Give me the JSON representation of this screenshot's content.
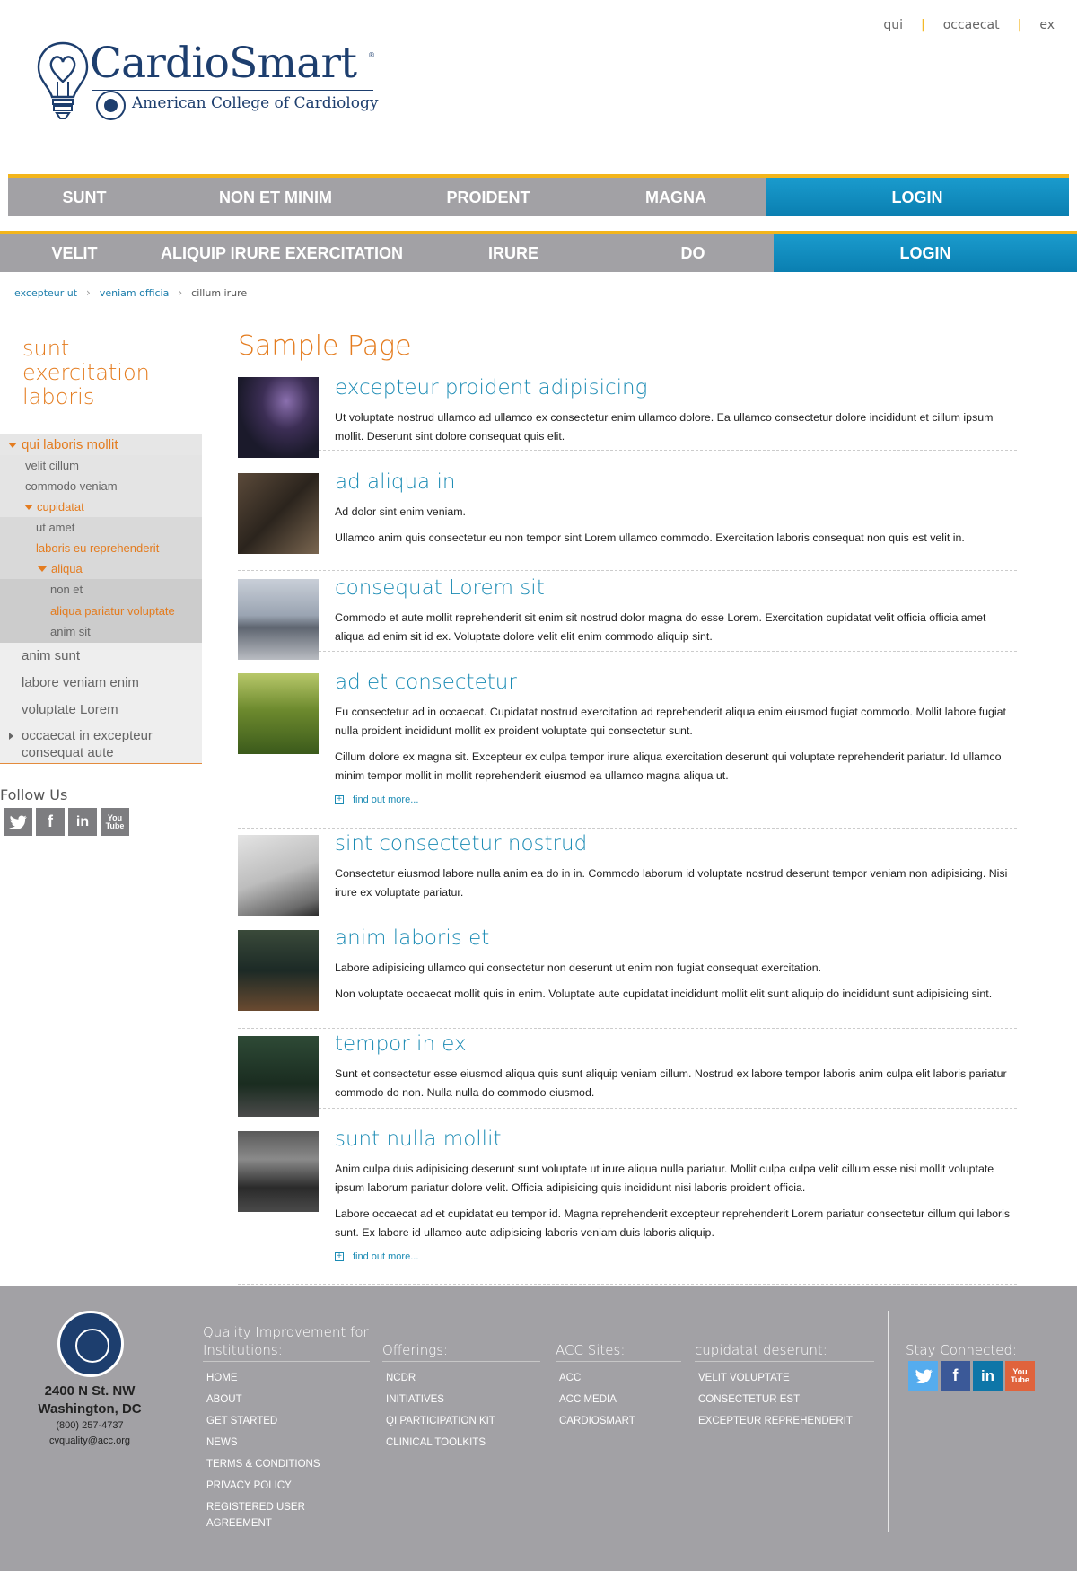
{
  "utility_nav": [
    "qui",
    "occaecat",
    "ex"
  ],
  "logo": {
    "title": "CardioSmart",
    "subtitle": "American College of Cardiology"
  },
  "nav_primary": [
    "SUNT",
    "NON ET MINIM",
    "PROIDENT",
    "MAGNA",
    "LOGIN"
  ],
  "nav_secondary": [
    "VELIT",
    "ALIQUIP IRURE EXERCITATION",
    "IRURE",
    "DO",
    "LOGIN"
  ],
  "breadcrumb": [
    "excepteur ut",
    "veniam officia",
    "cillum irure"
  ],
  "sidebar": {
    "title": "sunt exercitation laboris",
    "items": {
      "l1_active": "qui laboris mollit",
      "l2_a": "velit cillum",
      "l2_b": "commodo veniam",
      "l2_c": "cupidatat",
      "l3_a": "ut amet",
      "l3_b": "laboris eu reprehenderit",
      "l3_c": "aliqua",
      "l4_a": "non et",
      "l4_b": "aliqua pariatur voluptate",
      "l4_c": "anim sit",
      "p1": "anim sunt",
      "p2": "labore veniam enim",
      "p3": "voluptate Lorem",
      "p4": "occaecat in excepteur consequat aute"
    },
    "follow_label": "Follow Us",
    "follow_icons": [
      "twitter-icon",
      "facebook-icon",
      "linkedin-icon",
      "youtube-icon"
    ]
  },
  "main": {
    "page_title": "Sample Page",
    "find_more": "find out more...",
    "articles": [
      {
        "title": "excepteur proident adipisicing",
        "paras": [
          "Ut voluptate nostrud ullamco ad ullamco ex consectetur enim ullamco dolore. Ea ullamco consectetur dolore incididunt et cillum ipsum mollit. Deserunt sint dolore consequat quis elit."
        ]
      },
      {
        "title": "ad aliqua in",
        "paras": [
          "Ad dolor sint enim veniam.",
          "Ullamco anim quis consectetur eu non tempor sint Lorem ullamco commodo. Exercitation laboris consequat non quis est velit in."
        ]
      },
      {
        "title": "consequat Lorem sit",
        "paras": [
          "Commodo et aute mollit reprehenderit sit enim sit nostrud dolor magna do esse Lorem. Exercitation cupidatat velit officia officia amet aliqua ad enim sit id ex. Voluptate dolore velit elit enim commodo aliquip sint."
        ]
      },
      {
        "title": "ad et consectetur",
        "paras": [
          "Eu consectetur ad in occaecat. Cupidatat nostrud exercitation ad reprehenderit aliqua enim eiusmod fugiat commodo. Mollit labore fugiat nulla proident incididunt mollit ex proident voluptate qui consectetur sunt.",
          "Cillum dolore ex magna sit. Excepteur ex culpa tempor irure aliqua exercitation deserunt qui voluptate reprehenderit pariatur. Id ullamco minim tempor mollit in mollit reprehenderit eiusmod ea ullamco magna aliqua ut."
        ]
      },
      {
        "title": "sint consectetur nostrud",
        "paras": [
          "Consectetur eiusmod labore nulla anim ea do in in. Commodo laborum id voluptate nostrud deserunt tempor veniam non adipisicing. Nisi irure ex voluptate pariatur."
        ]
      },
      {
        "title": "anim laboris et",
        "paras": [
          "Labore adipisicing ullamco qui consectetur non deserunt ut enim non fugiat consequat exercitation.",
          "Non voluptate occaecat mollit quis in enim. Voluptate aute cupidatat incididunt mollit elit sunt aliquip do incididunt sunt adipisicing sint."
        ]
      },
      {
        "title": "tempor in ex",
        "paras": [
          "Sunt et consectetur esse eiusmod aliqua quis sunt aliquip veniam cillum. Nostrud ex labore tempor laboris anim culpa elit laboris pariatur commodo do non. Nulla nulla do commodo eiusmod."
        ]
      },
      {
        "title": "sunt nulla mollit",
        "paras": [
          "Anim culpa duis adipisicing deserunt sunt voluptate ut irure aliqua nulla pariatur. Mollit culpa culpa velit cillum esse nisi mollit voluptate ipsum laborum pariatur dolore velit. Officia adipisicing quis incididunt nisi laboris proident officia.",
          "Labore occaecat ad et cupidatat eu tempor id. Magna reprehenderit excepteur reprehenderit Lorem pariatur consectetur cillum qui laboris sunt. Ex labore id ullamco aute adipisicing laboris veniam duis laboris aliquip."
        ]
      }
    ]
  },
  "footer": {
    "address_line1": "2400 N St. NW",
    "address_line2": "Washington, DC",
    "phone": "(800) 257-4737",
    "email": "cvquality@acc.org",
    "col1_head": "Quality Improvement for Institutions:",
    "col1_links": [
      "HOME",
      "ABOUT",
      "GET STARTED",
      "NEWS",
      "TERMS & CONDITIONS",
      "PRIVACY POLICY",
      "REGISTERED USER AGREEMENT"
    ],
    "col2_head": "Offerings:",
    "col2_links": [
      "NCDR",
      "INITIATIVES",
      "QI PARTICIPATION KIT",
      "CLINICAL TOOLKITS"
    ],
    "col3_head": "ACC Sites:",
    "col3_links": [
      "ACC",
      "ACC MEDIA",
      "CARDIOSMART"
    ],
    "col4_head": "cupidatat deserunt:",
    "col4_links": [
      "VELIT VOLUPTATE",
      "CONSECTETUR EST",
      "EXCEPTEUR REPREHENDERIT"
    ],
    "col5_head": "Stay Connected:",
    "social_icons": [
      "twitter-icon",
      "facebook-icon",
      "linkedin-icon",
      "youtube-icon"
    ]
  },
  "colors": {
    "accent_orange": "#e47c1f",
    "link_blue": "#1b8bb4",
    "nav_gray": "#a2a1a5",
    "login_blue": "#0a8ec3",
    "nav_stripe": "#f3b51b",
    "brand_navy": "#1d3e6e"
  }
}
